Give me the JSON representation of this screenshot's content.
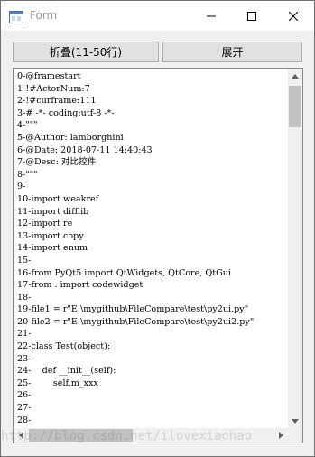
{
  "window": {
    "title": "Form",
    "title_color": "#999999",
    "icons": [
      "app-icon",
      "minimize-icon",
      "maximize-icon",
      "close-icon"
    ]
  },
  "toolbar": {
    "fold_label": "折叠(11-50行)",
    "expand_label": "展开"
  },
  "editor": {
    "lines": [
      "0-@framestart",
      "1-!#ActorNum:7",
      "2-!#curframe:111",
      "3-# -*- coding:utf-8 -*-",
      "4-\"\"\"",
      "5-@Author: lamborghini",
      "6-@Date: 2018-07-11 14:40:43",
      "7-@Desc: 对比控件",
      "8-\"\"\"",
      "9-",
      "10-import weakref",
      "11-import difflib",
      "12-import re",
      "13-import copy",
      "14-import enum",
      "15-",
      "16-from PyQt5 import QtWidgets, QtCore, QtGui",
      "17-from . import codewidget",
      "18-",
      "19-file1 = r\"E:\\mygithub\\FileCompare\\test\\py2ui.py\"",
      "20-file2 = r\"E:\\mygithub\\FileCompare\\test\\py2ui2.py\"",
      "21-",
      "22-class Test(object):",
      "23-",
      "24-    def __init__(self):",
      "25-        self.m_xxx",
      "26-",
      "27-",
      "28-"
    ]
  },
  "watermark": "http://blog.csdn.net/ilovexiaohao"
}
